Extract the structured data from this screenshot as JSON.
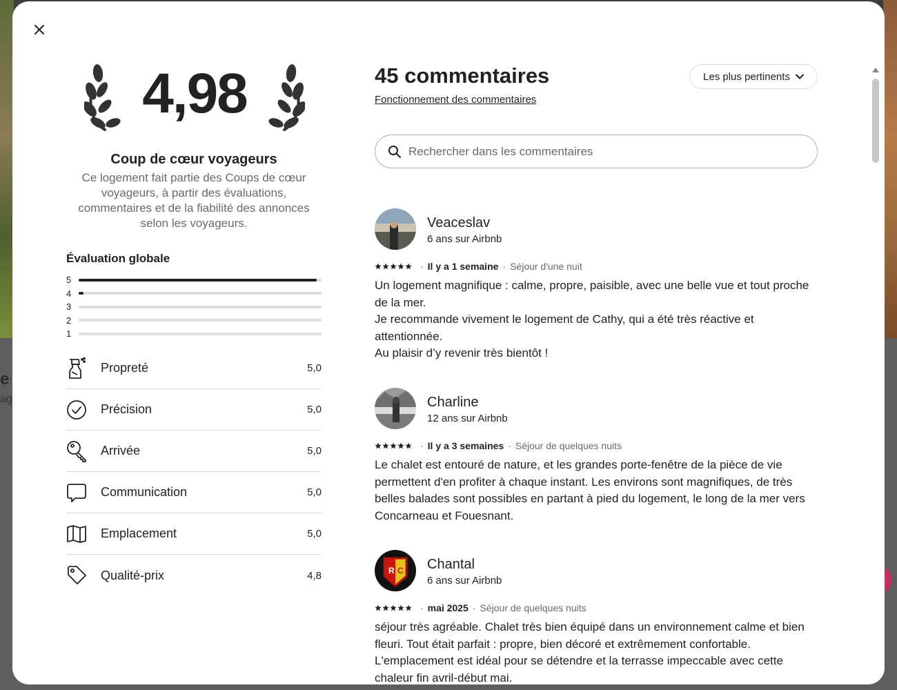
{
  "hero": {
    "rating": "4,98",
    "title": "Coup de cœur voyageurs",
    "description": "Ce logement fait partie des Coups de cœur voyageurs, à partir des évaluations, commentaires et de la fiabilité des annonces selon les voyageurs."
  },
  "overall": {
    "title": "Évaluation globale",
    "distribution": [
      {
        "label": "5",
        "fraction": 0.98
      },
      {
        "label": "4",
        "fraction": 0.02
      },
      {
        "label": "3",
        "fraction": 0
      },
      {
        "label": "2",
        "fraction": 0
      },
      {
        "label": "1",
        "fraction": 0
      }
    ]
  },
  "categories": [
    {
      "label": "Propreté",
      "value": "5,0",
      "icon": "spray-bottle-icon"
    },
    {
      "label": "Précision",
      "value": "5,0",
      "icon": "check-circle-icon"
    },
    {
      "label": "Arrivée",
      "value": "5,0",
      "icon": "key-icon"
    },
    {
      "label": "Communication",
      "value": "5,0",
      "icon": "chat-bubble-icon"
    },
    {
      "label": "Emplacement",
      "value": "5,0",
      "icon": "map-icon"
    },
    {
      "label": "Qualité-prix",
      "value": "4,8",
      "icon": "price-tag-icon"
    }
  ],
  "reviews_header": {
    "count_label": "45 commentaires",
    "how_link": "Fonctionnement des commentaires",
    "sort_label": "Les plus pertinents",
    "search_placeholder": "Rechercher dans les commentaires"
  },
  "reviews": [
    {
      "name": "Veaceslav",
      "tenure": "6 ans sur Airbnb",
      "stars": 5,
      "when": "Il y a 1 semaine",
      "stay": "Séjour d'une nuit",
      "lines": [
        "Un logement magnifique : calme, propre, paisible, avec une belle vue et tout proche de la mer.",
        "Je recommande vivement le logement de Cathy, qui a été très réactive et attentionnée.",
        "Au plaisir d’y revenir très bientôt !"
      ]
    },
    {
      "name": "Charline",
      "tenure": "12 ans sur Airbnb",
      "stars": 5,
      "when": "Il y a 3 semaines",
      "stay": "Séjour de quelques nuits",
      "lines": [
        "Le chalet est entouré de nature, et les grandes porte-fenêtre de la pièce de vie permettent d'en profiter à chaque instant. Les environs sont magnifiques, de très belles balades sont possibles en partant à pied du logement, le long de la mer vers Concarneau et Fouesnant."
      ]
    },
    {
      "name": "Chantal",
      "tenure": "6 ans sur Airbnb",
      "stars": 5,
      "when": "mai 2025",
      "stay": "Séjour de quelques nuits",
      "lines": [
        "séjour très agréable. Chalet très bien équipé dans un environnement calme et bien fleuri. Tout était parfait : propre, bien décoré et extrêmement confortable. L'emplacement est idéal pour se détendre et la terrasse impeccable avec cette chaleur fin avril-début mai."
      ]
    }
  ],
  "background": {
    "fragment_heading": "e",
    "fragment_sub": "ag"
  },
  "colors": {
    "text": "#222222",
    "muted": "#6a6a6a",
    "divider": "#dddddd",
    "accent": "#c72e63"
  }
}
